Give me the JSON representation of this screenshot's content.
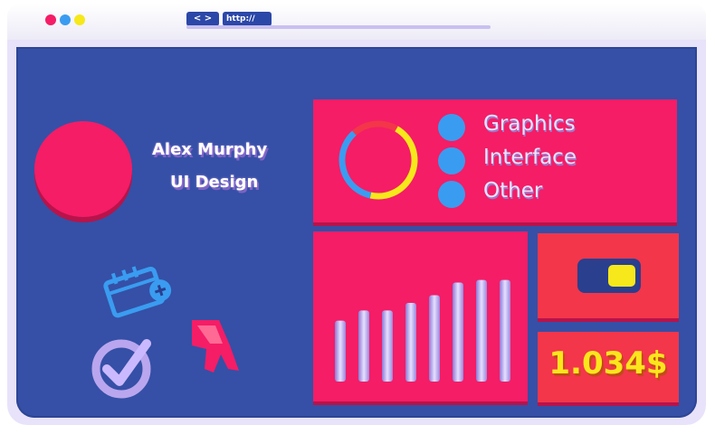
{
  "browser": {
    "nav_glyph": "< >",
    "url_text": "http://"
  },
  "profile": {
    "name": "Alex Murphy",
    "role": "UI Design"
  },
  "legend": {
    "items": [
      {
        "label": "Graphics"
      },
      {
        "label": "Interface"
      },
      {
        "label": "Other"
      }
    ],
    "donut_segments": [
      {
        "color": "#f6e81a",
        "fraction": 0.45
      },
      {
        "color": "#3a9cf0",
        "fraction": 0.35
      },
      {
        "color": "#f3364a",
        "fraction": 0.2
      }
    ]
  },
  "chart_data": {
    "type": "bar",
    "categories": [
      "",
      "",
      "",
      "",
      "",
      "",
      "",
      ""
    ],
    "values": [
      48,
      56,
      56,
      62,
      68,
      78,
      80,
      80
    ],
    "ylim": [
      0,
      100
    ],
    "title": "",
    "xlabel": "",
    "ylabel": ""
  },
  "toggle": {
    "state": "on"
  },
  "price": {
    "value": "1.034$"
  },
  "icons": [
    "calendar-icon",
    "checkmark-icon",
    "cursor-arrow-icon"
  ],
  "colors": {
    "screen": "#3550a6",
    "card_pink": "#f41d66",
    "card_red": "#f3364a",
    "accent_yellow": "#f6e81a",
    "accent_blue": "#3a9cf0"
  }
}
